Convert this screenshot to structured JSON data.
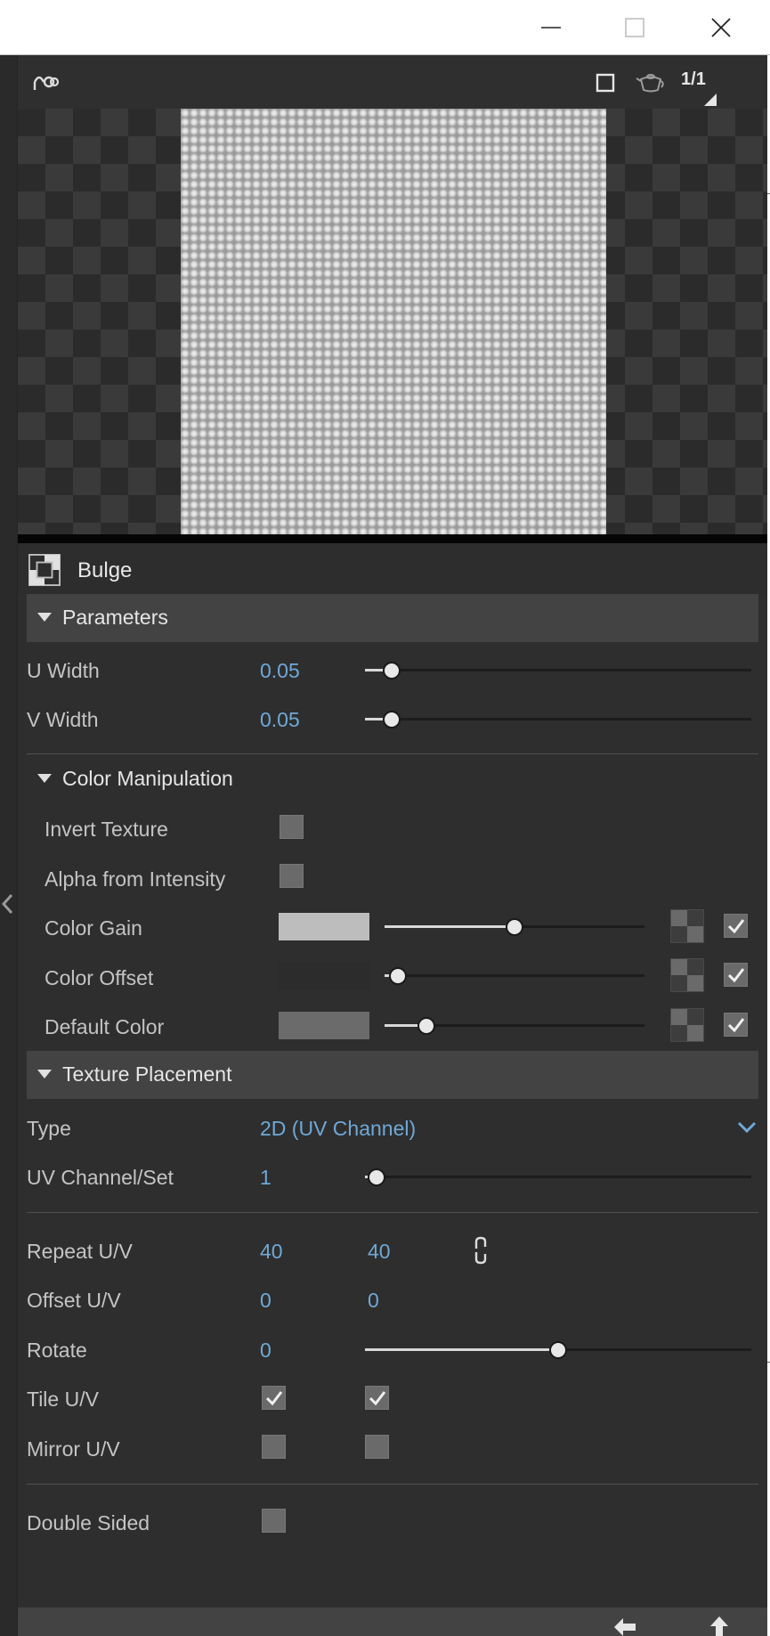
{
  "window": {
    "minimize_icon": "minimize-icon",
    "maximize_icon": "maximize-icon",
    "close_icon": "close-icon"
  },
  "preview": {
    "ratio_num": "1",
    "ratio_slash": "/",
    "ratio_den": "1"
  },
  "material": {
    "name": "Bulge"
  },
  "parameters": {
    "title": "Parameters",
    "u_width_label": "U Width",
    "u_width_value": "0.05",
    "u_width_level": 0.07,
    "v_width_label": "V Width",
    "v_width_value": "0.05",
    "v_width_level": 0.07
  },
  "color_manipulation": {
    "title": "Color Manipulation",
    "invert_label": "Invert Texture",
    "invert_checked": false,
    "alpha_label": "Alpha from Intensity",
    "alpha_checked": false,
    "gain_label": "Color Gain",
    "gain_color": "#bdbdbd",
    "gain_level": 0.5,
    "gain_enabled": true,
    "offset_label": "Color Offset",
    "offset_color": "#2c2c2c",
    "offset_level": 0.05,
    "offset_enabled": true,
    "default_label": "Default Color",
    "default_color": "#6b6b6b",
    "default_level": 0.16,
    "default_enabled": true
  },
  "texture_placement": {
    "title": "Texture Placement",
    "type_label": "Type",
    "type_value": "2D (UV Channel)",
    "uv_label": "UV Channel/Set",
    "uv_value": "1",
    "uv_level": 0.03,
    "repeat_label": "Repeat U/V",
    "repeat_u": "40",
    "repeat_v": "40",
    "offset_label": "Offset U/V",
    "offset_u": "0",
    "offset_v": "0",
    "rotate_label": "Rotate",
    "rotate_value": "0",
    "rotate_level": 0.5,
    "tile_label": "Tile U/V",
    "tile_u": true,
    "tile_v": true,
    "mirror_label": "Mirror U/V",
    "mirror_u": false,
    "mirror_v": false,
    "double_sided_label": "Double Sided",
    "double_sided": false
  },
  "colors": {
    "accent": "#6fa8d6",
    "panel": "#2e2e2e",
    "section": "#434343"
  }
}
